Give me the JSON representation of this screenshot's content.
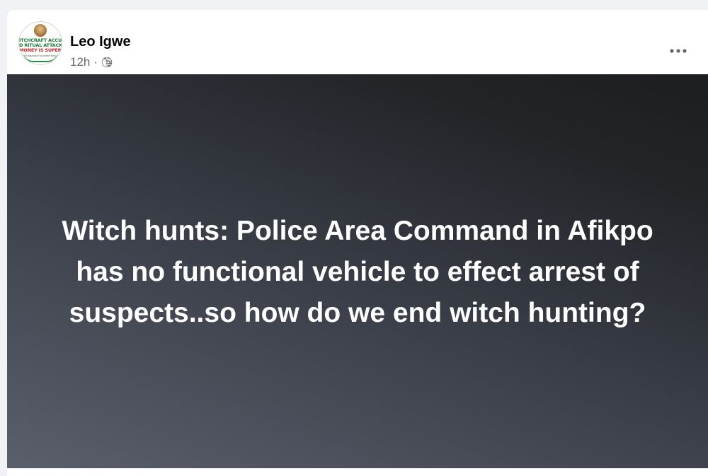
{
  "post": {
    "author": {
      "name": "Leo Igwe",
      "avatar_text": {
        "line1": "ITCHCRAFT ACCUS",
        "line2": "D RITUAL ATTACK",
        "line3": "MONEY IS SUPERS",
        "line4": "Join the advocacy to protect lives daily"
      }
    },
    "timestamp": "12h",
    "separator": "·",
    "audience_icon": "globe-icon",
    "menu_icon": "more-horizontal-icon",
    "body_text": "Witch hunts: Police Area Command in Afikpo has no functional vehicle to effect arrest of suspects..so how do we end witch hunting?"
  },
  "colors": {
    "page_background": "#f0f2f5",
    "card_background": "#ffffff",
    "name_text": "#050505",
    "meta_text": "#65676b",
    "post_text": "#ffffff",
    "media_gradient_start": "#5a5f6c",
    "media_gradient_end": "#1c1d21"
  }
}
